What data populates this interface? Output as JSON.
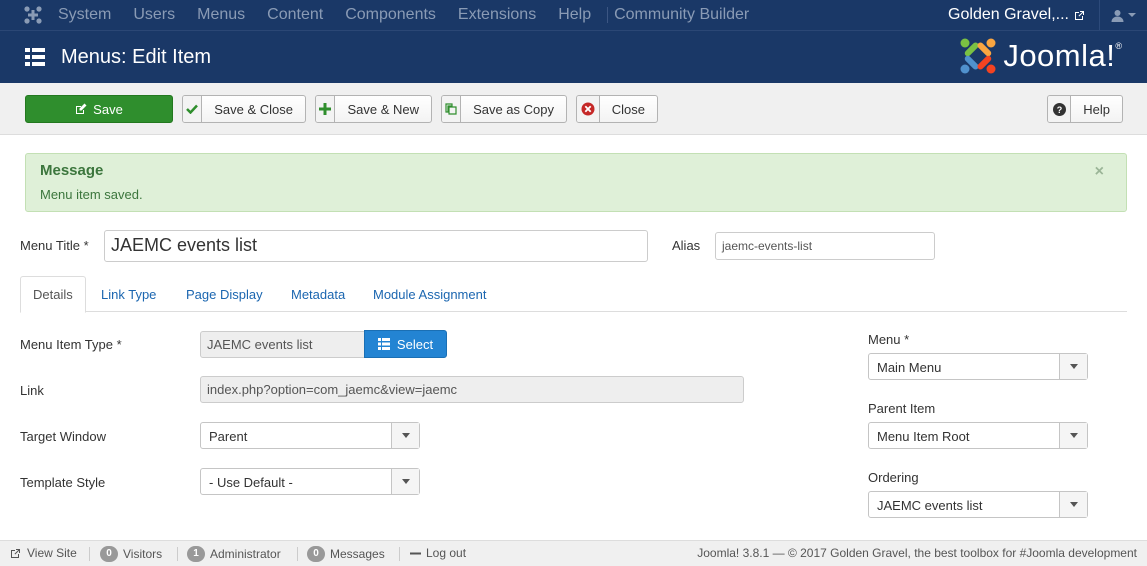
{
  "topnav": {
    "items": [
      "System",
      "Users",
      "Menus",
      "Content",
      "Components",
      "Extensions",
      "Help",
      "Community Builder"
    ],
    "site_name": "Golden Gravel,..."
  },
  "header": {
    "title": "Menus: Edit Item",
    "brand": "Joomla!",
    "brand_mark": "®"
  },
  "toolbar": {
    "save": "Save",
    "save_close": "Save & Close",
    "save_new": "Save & New",
    "save_copy": "Save as Copy",
    "close": "Close",
    "help": "Help"
  },
  "alert": {
    "heading": "Message",
    "text": "Menu item saved.",
    "close": "×"
  },
  "form": {
    "title_label": "Menu Title *",
    "title_value": "JAEMC events list",
    "alias_label": "Alias",
    "alias_value": "jaemc-events-list"
  },
  "tabs": [
    "Details",
    "Link Type",
    "Page Display",
    "Metadata",
    "Module Assignment"
  ],
  "details": {
    "menu_item_type_label": "Menu Item Type *",
    "menu_item_type_value": "JAEMC events list",
    "select_button": "Select",
    "link_label": "Link",
    "link_value": "index.php?option=com_jaemc&view=jaemc",
    "target_label": "Target Window",
    "target_value": "Parent",
    "template_label": "Template Style",
    "template_value": "- Use Default -"
  },
  "sidebar": {
    "menu_label": "Menu *",
    "menu_value": "Main Menu",
    "parent_label": "Parent Item",
    "parent_value": "Menu Item Root",
    "ordering_label": "Ordering",
    "ordering_value": "JAEMC events list"
  },
  "status": {
    "view_site": "View Site",
    "visitors_count": "0",
    "visitors": "Visitors",
    "admin_count": "1",
    "admin": "Administrator",
    "messages_count": "0",
    "messages": "Messages",
    "logout": "Log out",
    "copyright": "Joomla! 3.8.1 — © 2017 Golden Gravel, the best toolbox for #Joomla development"
  },
  "colors": {
    "navbar": "#1a3867",
    "save_green": "#2f8e2d",
    "link_blue": "#1b66b0",
    "select_blue": "#2384d3",
    "alert_bg": "#dff0d8"
  }
}
